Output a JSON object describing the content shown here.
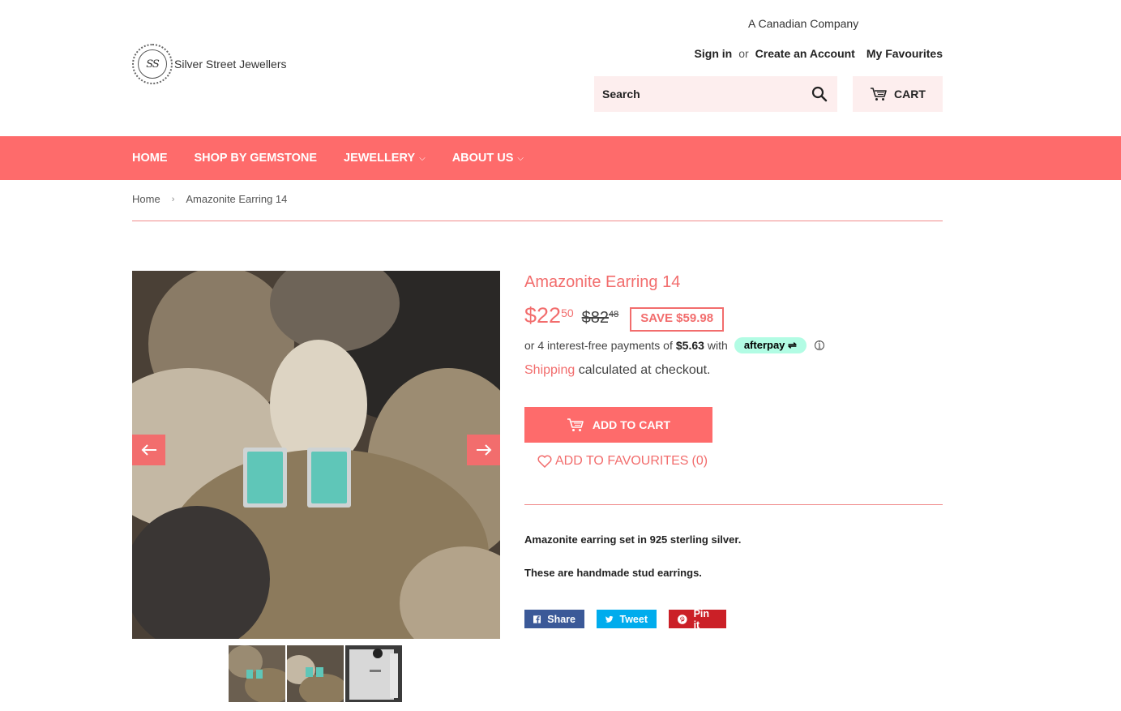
{
  "header": {
    "tagline": "A Canadian Company",
    "logo_monogram": "SS",
    "logo_text": "Silver Street Jewellers",
    "sign_in": "Sign in",
    "or": "or",
    "create_account": "Create an Account",
    "favourites": "My Favourites",
    "search_placeholder": "Search",
    "cart_label": "CART"
  },
  "nav": {
    "items": [
      {
        "label": "HOME",
        "has_menu": false
      },
      {
        "label": "SHOP BY GEMSTONE",
        "has_menu": false
      },
      {
        "label": "JEWELLERY",
        "has_menu": true
      },
      {
        "label": "ABOUT US",
        "has_menu": true
      }
    ]
  },
  "breadcrumb": {
    "home": "Home",
    "separator": "›",
    "current": "Amazonite Earring 14"
  },
  "product": {
    "title": "Amazonite Earring 14",
    "price_dollars": "$22",
    "price_cents": "50",
    "compare_dollars": "$82",
    "compare_cents": "48",
    "save_label": "SAVE $59.98",
    "afterpay_prefix": "or 4 interest-free payments of",
    "afterpay_amount": "$5.63",
    "afterpay_with": "with",
    "afterpay_brand": "afterpay",
    "shipping_link": "Shipping",
    "shipping_text": "calculated at checkout.",
    "add_to_cart": "ADD TO CART",
    "add_to_favourites": "ADD TO FAVOURITES",
    "favourites_count": "(0)",
    "description": [
      "Amazonite earring set in 925 sterling silver.",
      "These are handmade stud earrings."
    ],
    "gallery_thumbnail_count": 3
  },
  "share": {
    "facebook": "Share",
    "twitter": "Tweet",
    "pinterest": "Pin it"
  },
  "colors": {
    "accent": "#fe6b6b",
    "search_bg": "#fdeeee",
    "afterpay_mint": "#b2fce4",
    "facebook": "#3b5998",
    "twitter": "#00aced",
    "pinterest": "#cb2027"
  }
}
